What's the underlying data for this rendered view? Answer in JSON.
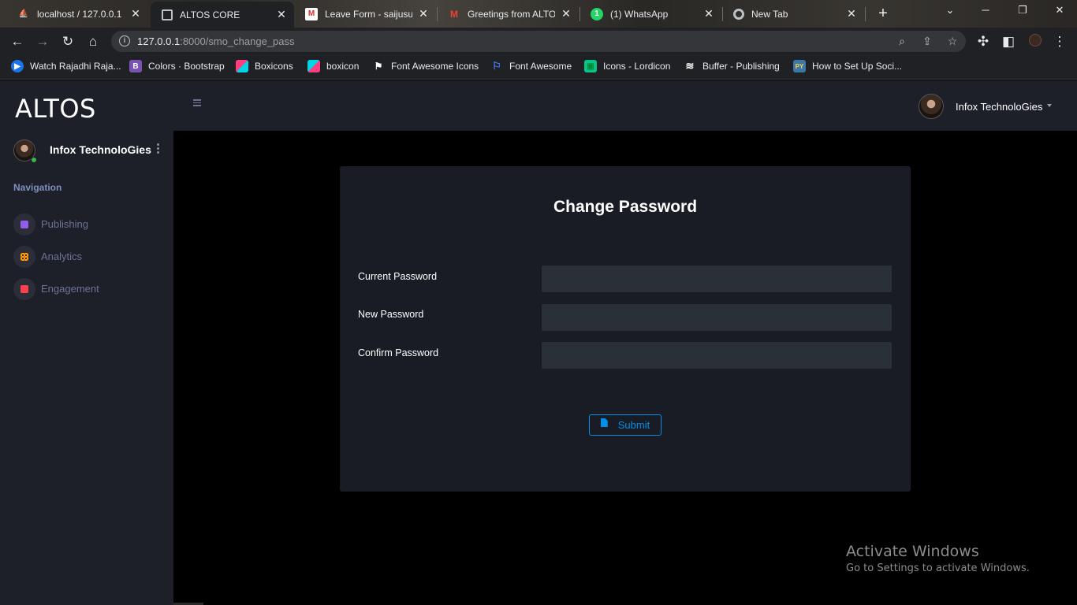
{
  "browser": {
    "tabs": [
      {
        "title": "localhost / 127.0.0.1 /",
        "icon": "phpmyadmin-icon",
        "active": false
      },
      {
        "title": "ALTOS CORE",
        "icon": "page-icon",
        "active": true
      },
      {
        "title": "Leave Form - saijusun",
        "icon": "gmail-icon",
        "active": false
      },
      {
        "title": "Greetings from ALTOS",
        "icon": "gmail-icon",
        "active": false
      },
      {
        "title": "(1) WhatsApp",
        "icon": "whatsapp-icon",
        "active": false
      },
      {
        "title": "New Tab",
        "icon": "chrome-icon",
        "active": false
      }
    ],
    "url_host": "127.0.0.1",
    "url_path": ":8000/smo_change_pass",
    "bookmarks": [
      {
        "label": "Watch Rajadhi Raja...",
        "icon": "play-icon"
      },
      {
        "label": "Colors · Bootstrap",
        "icon": "bootstrap-icon"
      },
      {
        "label": "Boxicons",
        "icon": "boxicons-icon"
      },
      {
        "label": "boxicon",
        "icon": "boxicons-icon"
      },
      {
        "label": "Font Awesome Icons",
        "icon": "flag-icon"
      },
      {
        "label": "Font Awesome",
        "icon": "flag-outline-icon"
      },
      {
        "label": "Icons - Lordicon",
        "icon": "lordicon-icon"
      },
      {
        "label": "Buffer - Publishing",
        "icon": "buffer-icon"
      },
      {
        "label": "How to Set Up Soci...",
        "icon": "python-icon"
      }
    ]
  },
  "sidebar": {
    "brand": "ALTOS",
    "user_name": "Infox TechnoloGies",
    "nav_title": "Navigation",
    "items": [
      {
        "label": "Publishing",
        "icon": "document-icon",
        "color": "#8f5fe8"
      },
      {
        "label": "Analytics",
        "icon": "grid-icon",
        "color": "#ffab00"
      },
      {
        "label": "Engagement",
        "icon": "list-icon",
        "color": "#fc424a"
      }
    ]
  },
  "topbar": {
    "user_name": "Infox TechnoloGies"
  },
  "form": {
    "title": "Change Password",
    "fields": [
      {
        "label": "Current Password",
        "value": ""
      },
      {
        "label": "New Password",
        "value": ""
      },
      {
        "label": "Confirm Password",
        "value": ""
      }
    ],
    "submit_label": "Submit",
    "accent": "#0090e7"
  },
  "watermark": {
    "line1": "Activate Windows",
    "line2": "Go to Settings to activate Windows."
  }
}
